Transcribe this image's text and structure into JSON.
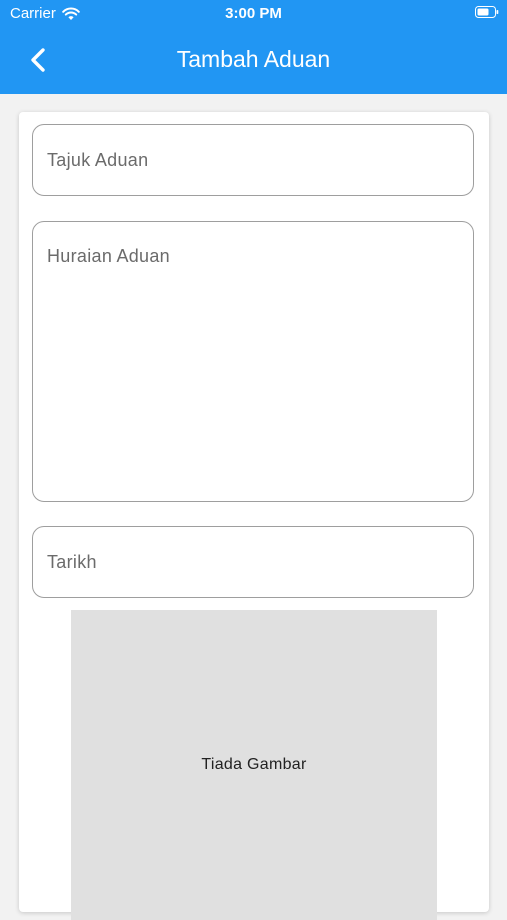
{
  "status_bar": {
    "carrier": "Carrier",
    "time": "3:00 PM",
    "icons": [
      "wifi-icon",
      "battery-icon"
    ]
  },
  "header": {
    "title": "Tambah Aduan",
    "back_icon": "chevron-left-icon",
    "background": "#2196f3"
  },
  "form": {
    "title_placeholder": "Tajuk Aduan",
    "description_placeholder": "Huraian Aduan",
    "date_placeholder": "Tarikh"
  },
  "image": {
    "empty_label": "Tiada Gambar"
  }
}
